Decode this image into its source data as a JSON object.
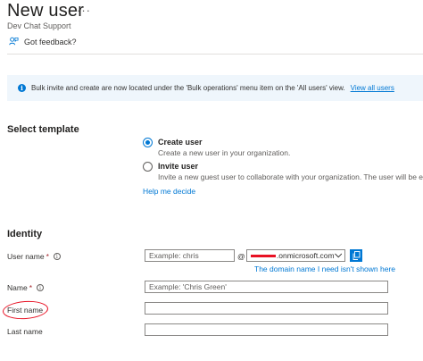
{
  "header": {
    "title": "New user",
    "more_glyph": "···",
    "subtitle": "Dev Chat Support",
    "feedback_label": "Got feedback?"
  },
  "banner": {
    "text": "Bulk invite and create are now located under the 'Bulk operations' menu item on the 'All users' view.",
    "link": "View all users",
    "info_glyph": "i"
  },
  "template": {
    "heading": "Select template",
    "options": [
      {
        "title": "Create user",
        "desc": "Create a new user in your organization.",
        "selected": true
      },
      {
        "title": "Invite user",
        "desc": "Invite a new guest user to collaborate with your organization. The user will be emaile",
        "selected": false
      }
    ],
    "help_link": "Help me decide"
  },
  "identity": {
    "heading": "Identity",
    "user_name_label": "User name",
    "user_name_placeholder": "Example: chris",
    "at_symbol": "@",
    "domain_suffix": ".onmicrosoft.com",
    "name_label": "Name",
    "name_placeholder": "Example: 'Chris Green'",
    "first_name_label": "First name",
    "last_name_label": "Last name",
    "required_mark": "*",
    "info_glyph": "i"
  },
  "annotation": {
    "text": "The domain name I need isn't shown here"
  },
  "colors": {
    "accent": "#0078d4",
    "annotation_red": "#e81123",
    "banner_bg": "#eff6fc"
  }
}
